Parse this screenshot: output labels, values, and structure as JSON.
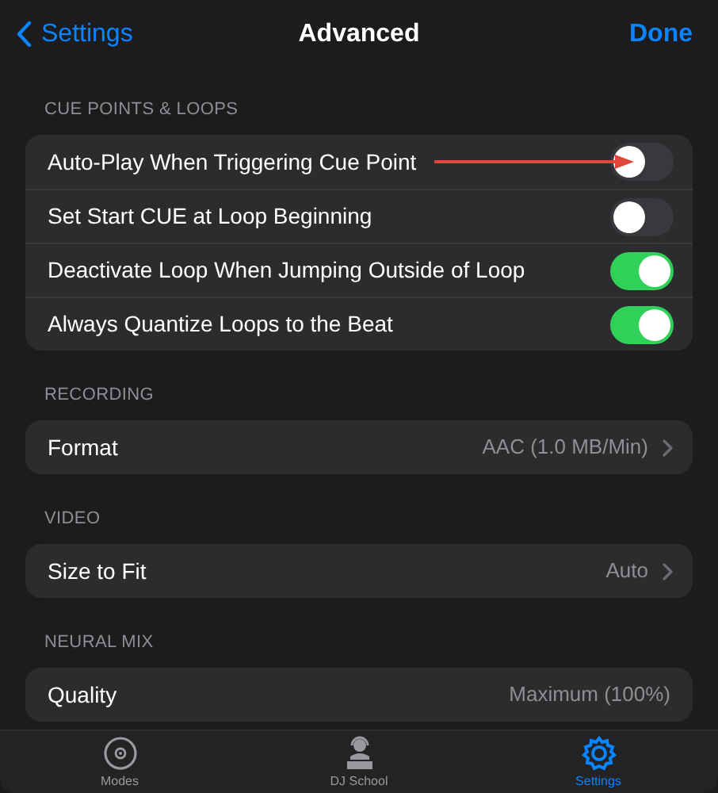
{
  "nav": {
    "back": "Settings",
    "title": "Advanced",
    "done": "Done"
  },
  "sections": [
    {
      "header": "CUE POINTS & LOOPS",
      "rows": [
        {
          "kind": "toggle",
          "label": "Auto-Play When Triggering Cue Point",
          "on": false,
          "pointer_arrow": true
        },
        {
          "kind": "toggle",
          "label": "Set Start CUE at Loop Beginning",
          "on": false,
          "pointer_arrow": false
        },
        {
          "kind": "toggle",
          "label": "Deactivate Loop When Jumping Outside of Loop",
          "on": true,
          "pointer_arrow": false
        },
        {
          "kind": "toggle",
          "label": "Always Quantize Loops to the Beat",
          "on": true,
          "pointer_arrow": false
        }
      ]
    },
    {
      "header": "RECORDING",
      "rows": [
        {
          "kind": "value",
          "label": "Format",
          "value": "AAC (1.0 MB/Min)",
          "chevron": true
        }
      ]
    },
    {
      "header": "VIDEO",
      "rows": [
        {
          "kind": "value",
          "label": "Size to Fit",
          "value": "Auto",
          "chevron": true
        }
      ]
    },
    {
      "header": "NEURAL MIX",
      "rows": [
        {
          "kind": "value",
          "label": "Quality",
          "value": "Maximum (100%)",
          "chevron": false
        }
      ]
    }
  ],
  "tab_bar": [
    {
      "kind": "disc",
      "label": "Modes",
      "selected": false
    },
    {
      "kind": "dj",
      "label": "DJ School",
      "selected": false
    },
    {
      "kind": "gear",
      "label": "Settings",
      "selected": true
    }
  ]
}
